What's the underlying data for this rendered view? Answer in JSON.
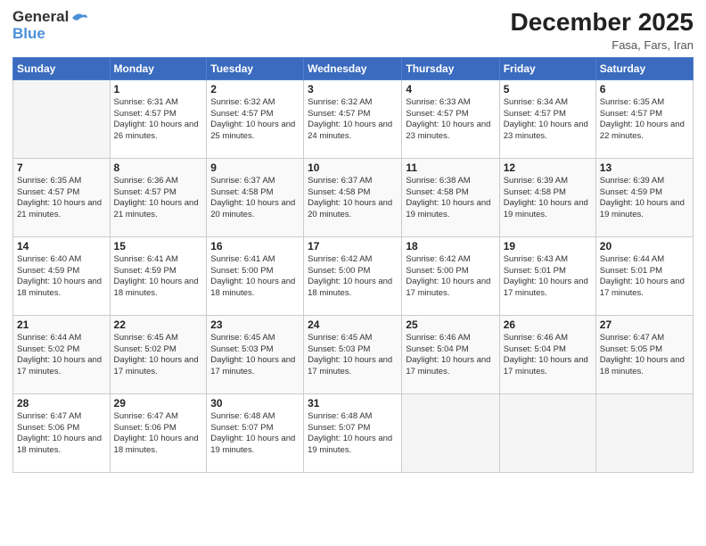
{
  "header": {
    "logo_general": "General",
    "logo_blue": "Blue",
    "title": "December 2025",
    "location": "Fasa, Fars, Iran"
  },
  "days_of_week": [
    "Sunday",
    "Monday",
    "Tuesday",
    "Wednesday",
    "Thursday",
    "Friday",
    "Saturday"
  ],
  "weeks": [
    [
      {
        "day": "",
        "sunrise": "",
        "sunset": "",
        "daylight": ""
      },
      {
        "day": "1",
        "sunrise": "Sunrise: 6:31 AM",
        "sunset": "Sunset: 4:57 PM",
        "daylight": "Daylight: 10 hours and 26 minutes."
      },
      {
        "day": "2",
        "sunrise": "Sunrise: 6:32 AM",
        "sunset": "Sunset: 4:57 PM",
        "daylight": "Daylight: 10 hours and 25 minutes."
      },
      {
        "day": "3",
        "sunrise": "Sunrise: 6:32 AM",
        "sunset": "Sunset: 4:57 PM",
        "daylight": "Daylight: 10 hours and 24 minutes."
      },
      {
        "day": "4",
        "sunrise": "Sunrise: 6:33 AM",
        "sunset": "Sunset: 4:57 PM",
        "daylight": "Daylight: 10 hours and 23 minutes."
      },
      {
        "day": "5",
        "sunrise": "Sunrise: 6:34 AM",
        "sunset": "Sunset: 4:57 PM",
        "daylight": "Daylight: 10 hours and 23 minutes."
      },
      {
        "day": "6",
        "sunrise": "Sunrise: 6:35 AM",
        "sunset": "Sunset: 4:57 PM",
        "daylight": "Daylight: 10 hours and 22 minutes."
      }
    ],
    [
      {
        "day": "7",
        "sunrise": "Sunrise: 6:35 AM",
        "sunset": "Sunset: 4:57 PM",
        "daylight": "Daylight: 10 hours and 21 minutes."
      },
      {
        "day": "8",
        "sunrise": "Sunrise: 6:36 AM",
        "sunset": "Sunset: 4:57 PM",
        "daylight": "Daylight: 10 hours and 21 minutes."
      },
      {
        "day": "9",
        "sunrise": "Sunrise: 6:37 AM",
        "sunset": "Sunset: 4:58 PM",
        "daylight": "Daylight: 10 hours and 20 minutes."
      },
      {
        "day": "10",
        "sunrise": "Sunrise: 6:37 AM",
        "sunset": "Sunset: 4:58 PM",
        "daylight": "Daylight: 10 hours and 20 minutes."
      },
      {
        "day": "11",
        "sunrise": "Sunrise: 6:38 AM",
        "sunset": "Sunset: 4:58 PM",
        "daylight": "Daylight: 10 hours and 19 minutes."
      },
      {
        "day": "12",
        "sunrise": "Sunrise: 6:39 AM",
        "sunset": "Sunset: 4:58 PM",
        "daylight": "Daylight: 10 hours and 19 minutes."
      },
      {
        "day": "13",
        "sunrise": "Sunrise: 6:39 AM",
        "sunset": "Sunset: 4:59 PM",
        "daylight": "Daylight: 10 hours and 19 minutes."
      }
    ],
    [
      {
        "day": "14",
        "sunrise": "Sunrise: 6:40 AM",
        "sunset": "Sunset: 4:59 PM",
        "daylight": "Daylight: 10 hours and 18 minutes."
      },
      {
        "day": "15",
        "sunrise": "Sunrise: 6:41 AM",
        "sunset": "Sunset: 4:59 PM",
        "daylight": "Daylight: 10 hours and 18 minutes."
      },
      {
        "day": "16",
        "sunrise": "Sunrise: 6:41 AM",
        "sunset": "Sunset: 5:00 PM",
        "daylight": "Daylight: 10 hours and 18 minutes."
      },
      {
        "day": "17",
        "sunrise": "Sunrise: 6:42 AM",
        "sunset": "Sunset: 5:00 PM",
        "daylight": "Daylight: 10 hours and 18 minutes."
      },
      {
        "day": "18",
        "sunrise": "Sunrise: 6:42 AM",
        "sunset": "Sunset: 5:00 PM",
        "daylight": "Daylight: 10 hours and 17 minutes."
      },
      {
        "day": "19",
        "sunrise": "Sunrise: 6:43 AM",
        "sunset": "Sunset: 5:01 PM",
        "daylight": "Daylight: 10 hours and 17 minutes."
      },
      {
        "day": "20",
        "sunrise": "Sunrise: 6:44 AM",
        "sunset": "Sunset: 5:01 PM",
        "daylight": "Daylight: 10 hours and 17 minutes."
      }
    ],
    [
      {
        "day": "21",
        "sunrise": "Sunrise: 6:44 AM",
        "sunset": "Sunset: 5:02 PM",
        "daylight": "Daylight: 10 hours and 17 minutes."
      },
      {
        "day": "22",
        "sunrise": "Sunrise: 6:45 AM",
        "sunset": "Sunset: 5:02 PM",
        "daylight": "Daylight: 10 hours and 17 minutes."
      },
      {
        "day": "23",
        "sunrise": "Sunrise: 6:45 AM",
        "sunset": "Sunset: 5:03 PM",
        "daylight": "Daylight: 10 hours and 17 minutes."
      },
      {
        "day": "24",
        "sunrise": "Sunrise: 6:45 AM",
        "sunset": "Sunset: 5:03 PM",
        "daylight": "Daylight: 10 hours and 17 minutes."
      },
      {
        "day": "25",
        "sunrise": "Sunrise: 6:46 AM",
        "sunset": "Sunset: 5:04 PM",
        "daylight": "Daylight: 10 hours and 17 minutes."
      },
      {
        "day": "26",
        "sunrise": "Sunrise: 6:46 AM",
        "sunset": "Sunset: 5:04 PM",
        "daylight": "Daylight: 10 hours and 17 minutes."
      },
      {
        "day": "27",
        "sunrise": "Sunrise: 6:47 AM",
        "sunset": "Sunset: 5:05 PM",
        "daylight": "Daylight: 10 hours and 18 minutes."
      }
    ],
    [
      {
        "day": "28",
        "sunrise": "Sunrise: 6:47 AM",
        "sunset": "Sunset: 5:06 PM",
        "daylight": "Daylight: 10 hours and 18 minutes."
      },
      {
        "day": "29",
        "sunrise": "Sunrise: 6:47 AM",
        "sunset": "Sunset: 5:06 PM",
        "daylight": "Daylight: 10 hours and 18 minutes."
      },
      {
        "day": "30",
        "sunrise": "Sunrise: 6:48 AM",
        "sunset": "Sunset: 5:07 PM",
        "daylight": "Daylight: 10 hours and 19 minutes."
      },
      {
        "day": "31",
        "sunrise": "Sunrise: 6:48 AM",
        "sunset": "Sunset: 5:07 PM",
        "daylight": "Daylight: 10 hours and 19 minutes."
      },
      {
        "day": "",
        "sunrise": "",
        "sunset": "",
        "daylight": ""
      },
      {
        "day": "",
        "sunrise": "",
        "sunset": "",
        "daylight": ""
      },
      {
        "day": "",
        "sunrise": "",
        "sunset": "",
        "daylight": ""
      }
    ]
  ]
}
